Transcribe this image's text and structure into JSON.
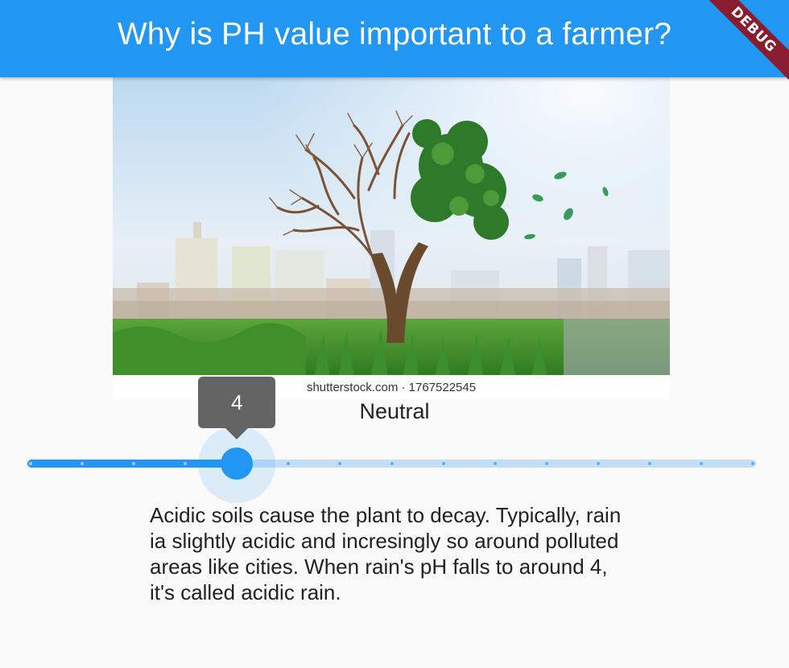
{
  "app_bar": {
    "title": "Why is PH value important to a farmer?"
  },
  "debug_banner": {
    "label": "DEBUG"
  },
  "hero_image": {
    "watermark": "shutterstock.com · 1767522545"
  },
  "status": {
    "label": "Neutral"
  },
  "ph_slider": {
    "value": 4,
    "value_label": "4",
    "min": 0,
    "max": 14,
    "divisions": 14,
    "active_color": "#2196f3",
    "inactive_color": "#c5def7"
  },
  "description": {
    "text": "Acidic soils cause the plant to decay. Typically, rain ia slightly acidic and incresingly so around polluted areas like cities. When rain's pH falls to around 4, it's called acidic rain."
  },
  "colors": {
    "primary": "#2196f3",
    "banner": "#8a1c30",
    "tooltip": "#646464",
    "background": "#fafafa"
  }
}
